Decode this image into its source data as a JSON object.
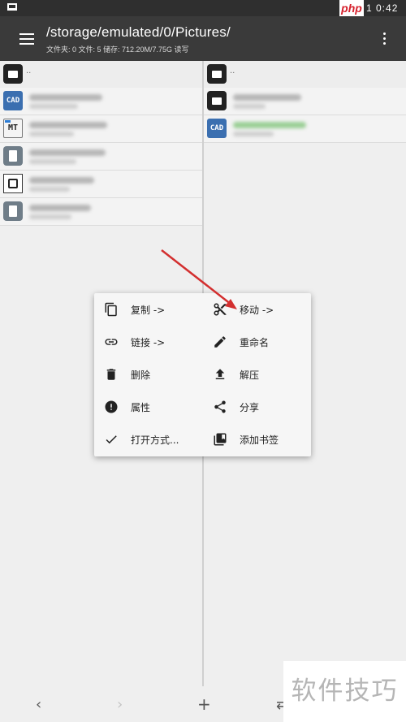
{
  "status_bar": {
    "badge": "php",
    "clock": "1 0:42"
  },
  "toolbar": {
    "path": "/storage/emulated/0/Pictures/",
    "summary": "文件夹: 0  文件: 5  储存: 712.20M/7.75G  读写"
  },
  "left_pane": {
    "up_label": ".."
  },
  "right_pane": {
    "up_label": ".."
  },
  "context_menu": {
    "copy": "复制 ->",
    "move": "移动 ->",
    "link": "链接 ->",
    "rename": "重命名",
    "delete": "删除",
    "extract": "解压",
    "properties": "属性",
    "share": "分享",
    "open_with": "打开方式...",
    "add_bookmark": "添加书签"
  },
  "bottom_bar": {
    "back": "‹",
    "forward": "›",
    "add": "+",
    "swap": "⇄"
  },
  "watermark": "软件技巧",
  "colors": {
    "app_bar": "#3a3a3a",
    "arrow": "#d32f2f",
    "accent_green": "#76c06f"
  }
}
